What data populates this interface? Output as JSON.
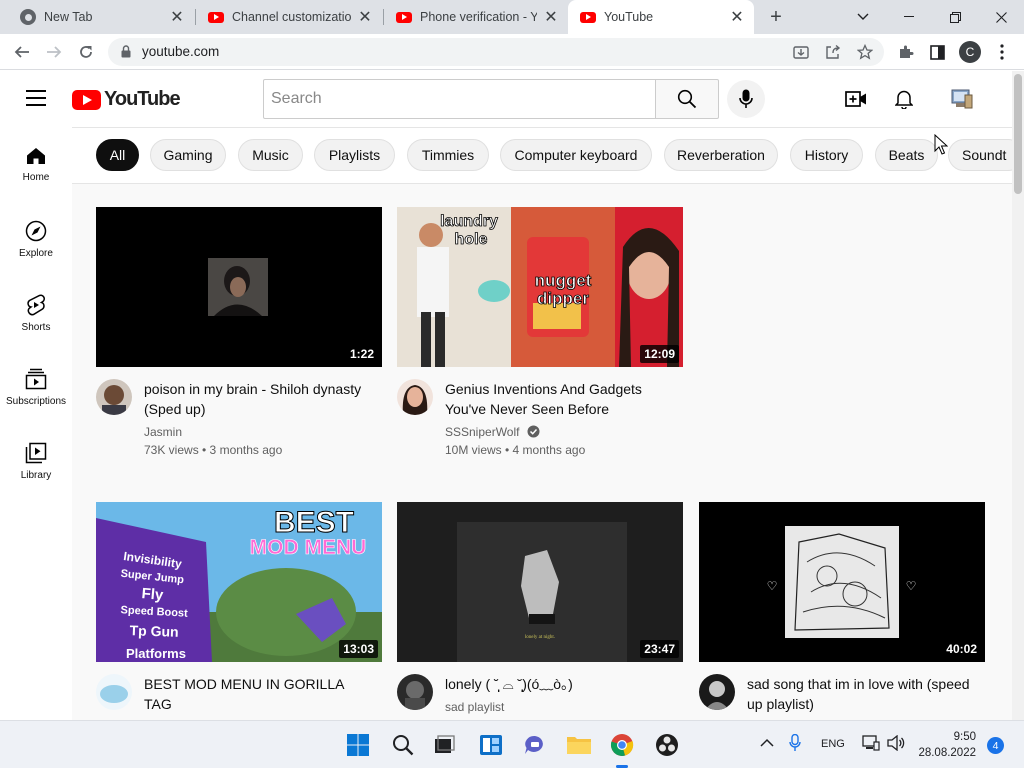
{
  "browser": {
    "tabs": [
      {
        "title": "New Tab",
        "icon": "chrome-icon",
        "active": false
      },
      {
        "title": "Channel customization",
        "icon": "youtube-favicon",
        "active": false
      },
      {
        "title": "Phone verification - You",
        "icon": "youtube-favicon",
        "active": false
      },
      {
        "title": "YouTube",
        "icon": "youtube-favicon",
        "active": true
      }
    ],
    "new_tab_symbol": "+",
    "address": "youtube.com",
    "profile_initial": "C"
  },
  "header": {
    "logo_text": "YouTube",
    "search_placeholder": "Search"
  },
  "sidebar": {
    "items": [
      {
        "label": "Home",
        "icon": "home-icon"
      },
      {
        "label": "Explore",
        "icon": "compass-icon"
      },
      {
        "label": "Shorts",
        "icon": "shorts-icon"
      },
      {
        "label": "Subscriptions",
        "icon": "subscriptions-icon"
      },
      {
        "label": "Library",
        "icon": "library-icon"
      }
    ]
  },
  "chips": [
    "All",
    "Gaming",
    "Music",
    "Playlists",
    "Timmies",
    "Computer keyboard",
    "Reverberation",
    "History",
    "Beats",
    "Soundt"
  ],
  "videos": [
    {
      "title": "poison in my brain - Shiloh dynasty (Sped up)",
      "channel": "Jasmin",
      "stats": "73K views • 3 months ago",
      "duration": "1:22"
    },
    {
      "title": "Genius Inventions And Gadgets You've Never Seen Before",
      "channel": "SSSniperWolf",
      "stats": "10M views • 4 months ago",
      "duration": "12:09",
      "verified": true,
      "thumb_text": [
        "laundry",
        "hole",
        "nugget",
        "dipper"
      ]
    },
    {
      "title": "BEST MOD MENU IN GORILLA TAG",
      "channel": "",
      "stats": "",
      "duration": "13:03",
      "thumb_text": [
        "BEST",
        "MOD MENU",
        "Invisibility",
        "Super Jump",
        "Fly",
        "Speed Boost",
        "Tp Gun",
        "Platforms"
      ]
    },
    {
      "title": "lonely ( ˘̩̩̩̩̩̩ ⌓ ˘̩̩̩̩̩̩)(ó﹏ò｡)",
      "channel": "sad playlist",
      "stats": "",
      "duration": "23:47"
    },
    {
      "title": "sad song that im in love with (speed up playlist)",
      "channel": "",
      "stats": "",
      "duration": "40:02"
    }
  ],
  "taskbar": {
    "language": "ENG",
    "time": "9:50",
    "date": "28.08.2022",
    "notifications": "4"
  },
  "colors": {
    "youtube_red": "#ff0000",
    "chip_selected": "#0f0f0f",
    "taskbar": "#eef1f6"
  }
}
